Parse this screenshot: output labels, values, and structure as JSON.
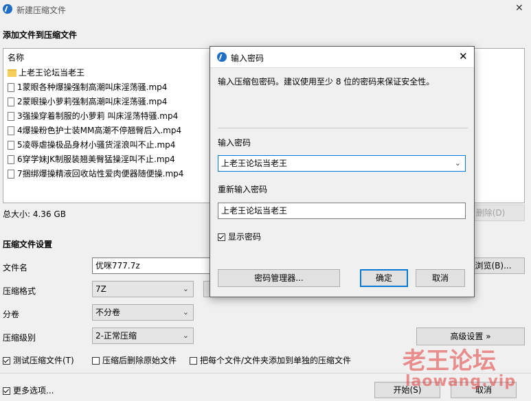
{
  "window": {
    "title": "新建压缩文件",
    "close_glyph": "✕"
  },
  "add_section": {
    "title": "添加文件到压缩文件",
    "column_header": "名称"
  },
  "files": [
    {
      "name": "上老王论坛当老王",
      "type": "folder"
    },
    {
      "name": "1蒙眼各种爆操强制高潮叫床淫荡骚.mp4",
      "type": "file"
    },
    {
      "name": "2蒙眼操小萝莉强制高潮叫床淫荡骚.mp4",
      "type": "file"
    },
    {
      "name": "3强操穿着制服的小萝莉 叫床淫荡特骚.mp4",
      "type": "file"
    },
    {
      "name": "4爆操粉色护士装MM高潮不停翘臀后入.mp4",
      "type": "file"
    },
    {
      "name": "5凌辱虐操极品身材小骚货淫浪叫不止.mp4",
      "type": "file"
    },
    {
      "name": "6穿学妹JK制服装翘美臀猛操淫叫不止.mp4",
      "type": "file"
    },
    {
      "name": "7捆绑爆操精液回收站性爱肉便器随便操.mp4",
      "type": "file"
    }
  ],
  "total_size": "总大小: 4.36 GB",
  "delete_button": "删除(D)",
  "settings": {
    "title": "压缩文件设置",
    "filename_label": "文件名",
    "filename_value": "优咪777.7z",
    "browse_button": "浏览(B)...",
    "format_label": "压缩格式",
    "format_value": "7Z",
    "volume_label": "分卷",
    "volume_value": "不分卷",
    "level_label": "压缩级别",
    "level_value": "2-正常压缩",
    "advanced_button": "高级设置 »"
  },
  "options": {
    "test_label": "测试压缩文件(T)",
    "delete_after_label": "压缩后删除原始文件",
    "separate_label": "把每个文件/文件夹添加到单独的压缩文件",
    "more_label": "更多选项..."
  },
  "footer": {
    "start_button": "开始(S)",
    "cancel_button": "取消"
  },
  "dialog": {
    "title": "输入密码",
    "hint": "输入压缩包密码。建议使用至少 8 位的密码来保证安全性。",
    "password_label": "输入密码",
    "password_value": "上老王论坛当老王",
    "reenter_label": "重新输入密码",
    "reenter_value": "上老王论坛当老王",
    "show_password_label": "显示密码",
    "manager_button": "密码管理器...",
    "ok_button": "确定",
    "cancel_button": "取消"
  },
  "watermark": {
    "line1": "老王论坛",
    "line2": "laowang.vip"
  },
  "colors": {
    "accent": "#0078d7",
    "app_icon": "#1e6ec8",
    "watermark": "#e23b3b"
  }
}
